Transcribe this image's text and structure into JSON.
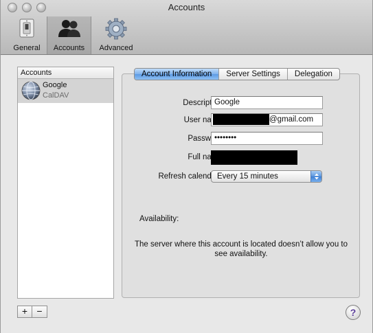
{
  "window": {
    "title": "Accounts"
  },
  "toolbar": {
    "items": [
      {
        "label": "General",
        "icon": "light-switch-icon",
        "selected": false
      },
      {
        "label": "Accounts",
        "icon": "people-icon",
        "selected": true
      },
      {
        "label": "Advanced",
        "icon": "gear-icon",
        "selected": false
      }
    ]
  },
  "sidebar": {
    "header": "Accounts",
    "accounts": [
      {
        "name": "Google",
        "type": "CalDAV",
        "icon": "globe-icon"
      }
    ],
    "add_label": "+",
    "remove_label": "−"
  },
  "tabs": [
    {
      "label": "Account Information",
      "active": true
    },
    {
      "label": "Server Settings",
      "active": false
    },
    {
      "label": "Delegation",
      "active": false
    }
  ],
  "form": {
    "description_label": "Description:",
    "description_value": "Google",
    "username_label": "User name:",
    "username_suffix": "@gmail.com",
    "password_label": "Password:",
    "password_value": "••••••••",
    "fullname_label": "Full name:",
    "refresh_label": "Refresh calendars:",
    "refresh_value": "Every 15 minutes",
    "availability_label": "Availability:",
    "availability_message_line1": "The server where this account is located doesn’t allow you to",
    "availability_message_line2": "see availability."
  },
  "help": {
    "label": "?"
  },
  "colors": {
    "tab_active": "#6aa4e8",
    "selection_row": "#d4d4d4",
    "help_glyph": "#5b3e9a"
  }
}
